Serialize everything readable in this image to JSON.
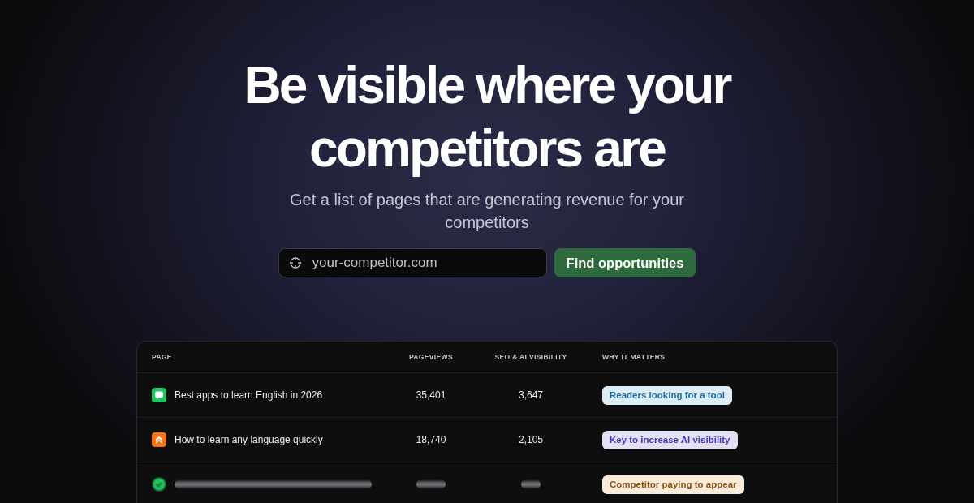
{
  "hero": {
    "headline": "Be visible where your competitors are",
    "subtitle": "Get a list of pages that are generating revenue for your competitors"
  },
  "search": {
    "placeholder": "your-competitor.com",
    "button": "Find opportunities"
  },
  "table": {
    "columns": [
      "PAGE",
      "PAGEVIEWS",
      "SEO & AI VISIBILITY",
      "WHY IT MATTERS"
    ],
    "rows": [
      {
        "page": "Best apps to learn English in 2026",
        "color": "#22c55e",
        "pageviews": "35,401",
        "visibility": "3,647",
        "why": {
          "label": "Readers looking for a tool",
          "color": "#1f6da3"
        },
        "blurred": false
      },
      {
        "page": "How to learn any language quickly",
        "color": "#f97316",
        "pageviews": "18,740",
        "visibility": "2,105",
        "why": {
          "label": "Key to increase AI visibility",
          "color": "#4338b8"
        },
        "blurred": false
      },
      {
        "color": "#22c55e",
        "why": {
          "label": "Competitor paying to appear",
          "color": "#8f5214"
        },
        "blurred": true
      }
    ]
  }
}
